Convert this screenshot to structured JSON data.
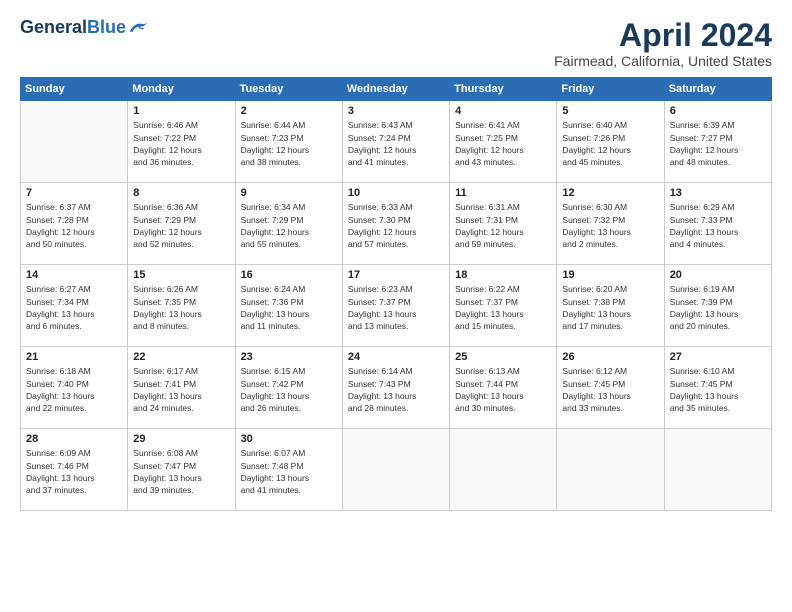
{
  "header": {
    "logo": {
      "general": "General",
      "blue": "Blue"
    },
    "title": "April 2024",
    "location": "Fairmead, California, United States"
  },
  "calendar": {
    "weekdays": [
      "Sunday",
      "Monday",
      "Tuesday",
      "Wednesday",
      "Thursday",
      "Friday",
      "Saturday"
    ],
    "weeks": [
      [
        {
          "day": "",
          "info": ""
        },
        {
          "day": "1",
          "info": "Sunrise: 6:46 AM\nSunset: 7:22 PM\nDaylight: 12 hours\nand 36 minutes."
        },
        {
          "day": "2",
          "info": "Sunrise: 6:44 AM\nSunset: 7:23 PM\nDaylight: 12 hours\nand 38 minutes."
        },
        {
          "day": "3",
          "info": "Sunrise: 6:43 AM\nSunset: 7:24 PM\nDaylight: 12 hours\nand 41 minutes."
        },
        {
          "day": "4",
          "info": "Sunrise: 6:41 AM\nSunset: 7:25 PM\nDaylight: 12 hours\nand 43 minutes."
        },
        {
          "day": "5",
          "info": "Sunrise: 6:40 AM\nSunset: 7:26 PM\nDaylight: 12 hours\nand 45 minutes."
        },
        {
          "day": "6",
          "info": "Sunrise: 6:39 AM\nSunset: 7:27 PM\nDaylight: 12 hours\nand 48 minutes."
        }
      ],
      [
        {
          "day": "7",
          "info": "Sunrise: 6:37 AM\nSunset: 7:28 PM\nDaylight: 12 hours\nand 50 minutes."
        },
        {
          "day": "8",
          "info": "Sunrise: 6:36 AM\nSunset: 7:29 PM\nDaylight: 12 hours\nand 52 minutes."
        },
        {
          "day": "9",
          "info": "Sunrise: 6:34 AM\nSunset: 7:29 PM\nDaylight: 12 hours\nand 55 minutes."
        },
        {
          "day": "10",
          "info": "Sunrise: 6:33 AM\nSunset: 7:30 PM\nDaylight: 12 hours\nand 57 minutes."
        },
        {
          "day": "11",
          "info": "Sunrise: 6:31 AM\nSunset: 7:31 PM\nDaylight: 12 hours\nand 59 minutes."
        },
        {
          "day": "12",
          "info": "Sunrise: 6:30 AM\nSunset: 7:32 PM\nDaylight: 13 hours\nand 2 minutes."
        },
        {
          "day": "13",
          "info": "Sunrise: 6:29 AM\nSunset: 7:33 PM\nDaylight: 13 hours\nand 4 minutes."
        }
      ],
      [
        {
          "day": "14",
          "info": "Sunrise: 6:27 AM\nSunset: 7:34 PM\nDaylight: 13 hours\nand 6 minutes."
        },
        {
          "day": "15",
          "info": "Sunrise: 6:26 AM\nSunset: 7:35 PM\nDaylight: 13 hours\nand 8 minutes."
        },
        {
          "day": "16",
          "info": "Sunrise: 6:24 AM\nSunset: 7:36 PM\nDaylight: 13 hours\nand 11 minutes."
        },
        {
          "day": "17",
          "info": "Sunrise: 6:23 AM\nSunset: 7:37 PM\nDaylight: 13 hours\nand 13 minutes."
        },
        {
          "day": "18",
          "info": "Sunrise: 6:22 AM\nSunset: 7:37 PM\nDaylight: 13 hours\nand 15 minutes."
        },
        {
          "day": "19",
          "info": "Sunrise: 6:20 AM\nSunset: 7:38 PM\nDaylight: 13 hours\nand 17 minutes."
        },
        {
          "day": "20",
          "info": "Sunrise: 6:19 AM\nSunset: 7:39 PM\nDaylight: 13 hours\nand 20 minutes."
        }
      ],
      [
        {
          "day": "21",
          "info": "Sunrise: 6:18 AM\nSunset: 7:40 PM\nDaylight: 13 hours\nand 22 minutes."
        },
        {
          "day": "22",
          "info": "Sunrise: 6:17 AM\nSunset: 7:41 PM\nDaylight: 13 hours\nand 24 minutes."
        },
        {
          "day": "23",
          "info": "Sunrise: 6:15 AM\nSunset: 7:42 PM\nDaylight: 13 hours\nand 26 minutes."
        },
        {
          "day": "24",
          "info": "Sunrise: 6:14 AM\nSunset: 7:43 PM\nDaylight: 13 hours\nand 28 minutes."
        },
        {
          "day": "25",
          "info": "Sunrise: 6:13 AM\nSunset: 7:44 PM\nDaylight: 13 hours\nand 30 minutes."
        },
        {
          "day": "26",
          "info": "Sunrise: 6:12 AM\nSunset: 7:45 PM\nDaylight: 13 hours\nand 33 minutes."
        },
        {
          "day": "27",
          "info": "Sunrise: 6:10 AM\nSunset: 7:45 PM\nDaylight: 13 hours\nand 35 minutes."
        }
      ],
      [
        {
          "day": "28",
          "info": "Sunrise: 6:09 AM\nSunset: 7:46 PM\nDaylight: 13 hours\nand 37 minutes."
        },
        {
          "day": "29",
          "info": "Sunrise: 6:08 AM\nSunset: 7:47 PM\nDaylight: 13 hours\nand 39 minutes."
        },
        {
          "day": "30",
          "info": "Sunrise: 6:07 AM\nSunset: 7:48 PM\nDaylight: 13 hours\nand 41 minutes."
        },
        {
          "day": "",
          "info": ""
        },
        {
          "day": "",
          "info": ""
        },
        {
          "day": "",
          "info": ""
        },
        {
          "day": "",
          "info": ""
        }
      ]
    ]
  }
}
